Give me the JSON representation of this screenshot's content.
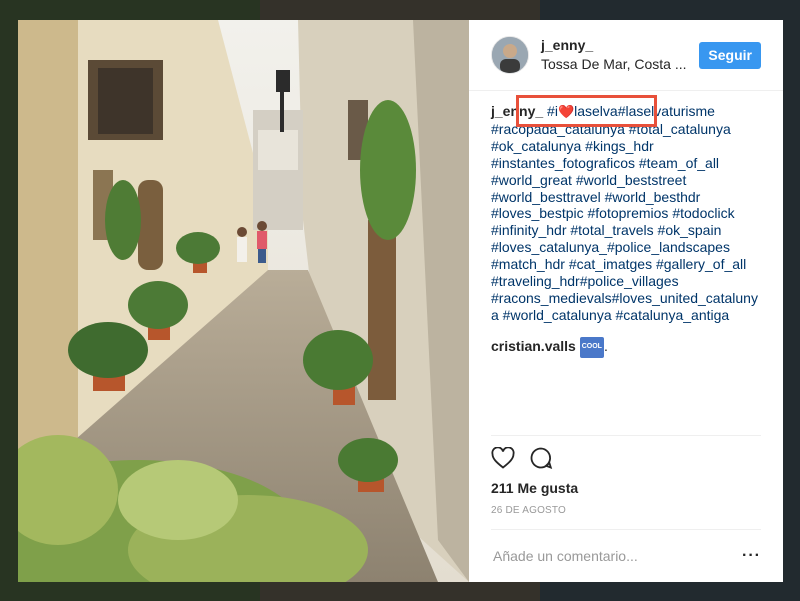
{
  "post": {
    "username": "j_enny_",
    "location": "Tossa De Mar, Costa ...",
    "follow_label": "Seguir",
    "caption_lines": [
      [
        "#i",
        "❤️",
        "laselva#laselvaturisme"
      ],
      "#racopada_catalunya #total_catalunya",
      "#ok_catalunya #kings_hdr",
      "#instantes_fotograficos #team_of_all",
      "#world_great #world_beststreet",
      "#world_besttravel #world_besthdr",
      "#loves_bestpic #fotopremios #todoclick",
      "#infinity_hdr #total_travels #ok_spain",
      "#loves_catalunya_#police_landscapes",
      "#match_hdr #cat_imatges #gallery_of_all",
      "#traveling_hdr#police_villages",
      "#racons_medievals#loves_united_cataluny",
      "a #world_catalunya #catalunya_antiga"
    ],
    "comment_user": "cristian.valls",
    "comment_emoji": "COOL",
    "comment_suffix": ".",
    "likes": "211 Me gusta",
    "date": "26 DE AGOSTO",
    "comment_placeholder": "Añade un comentario...",
    "more_label": "···",
    "icons": {
      "like": "heart-outline-icon",
      "comment": "speech-bubble-icon"
    },
    "colors": {
      "accent": "#3897f0",
      "hashtag": "#003569",
      "highlight": "#e8503a"
    }
  }
}
